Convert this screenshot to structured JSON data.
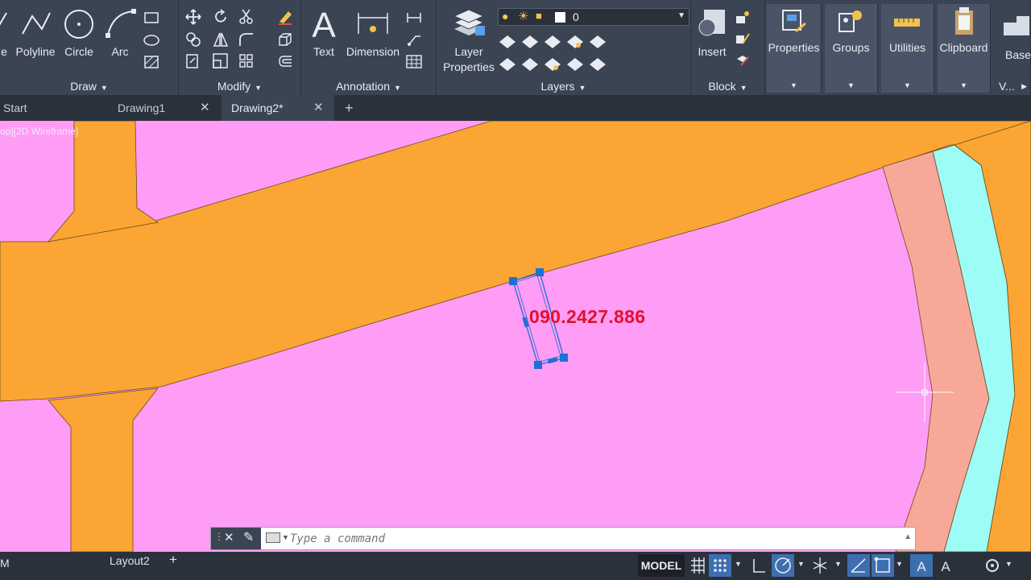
{
  "ribbon": {
    "draw": {
      "title": "Draw",
      "line_label": "e",
      "polyline_label": "Polyline",
      "circle_label": "Circle",
      "arc_label": "Arc"
    },
    "modify": {
      "title": "Modify"
    },
    "annotation": {
      "title": "Annotation",
      "text_label": "Text",
      "dimension_label": "Dimension"
    },
    "layers": {
      "title": "Layers",
      "layer_properties_label_1": "Layer",
      "layer_properties_label_2": "Properties",
      "current_layer": "0"
    },
    "block": {
      "title": "Block",
      "insert_label": "Insert"
    },
    "properties_label": "Properties",
    "groups_label": "Groups",
    "utilities_label": "Utilities",
    "clipboard_label": "Clipboard",
    "base_label": "Base",
    "view_label": "V..."
  },
  "tabs": {
    "start": "Start",
    "drawing1": "Drawing1",
    "drawing2": "Drawing2*",
    "close": "✕",
    "add": "+"
  },
  "viewport": {
    "label": "op][2D Wireframe]"
  },
  "drawing": {
    "phone_text": "090.2427.886"
  },
  "command": {
    "placeholder": "Type a command"
  },
  "layout_tabs": {
    "left_fragment": "M",
    "layout2": "Layout2",
    "add": "+"
  },
  "status": {
    "model": "MODEL"
  },
  "colors": {
    "ribbon": "#3b4453",
    "road": "#fba534",
    "parcel": "#ff9cf5",
    "salmon": "#f8a898",
    "water": "#9dfcf6",
    "selection": "#1e6fd6",
    "text_red": "#e0122f"
  }
}
